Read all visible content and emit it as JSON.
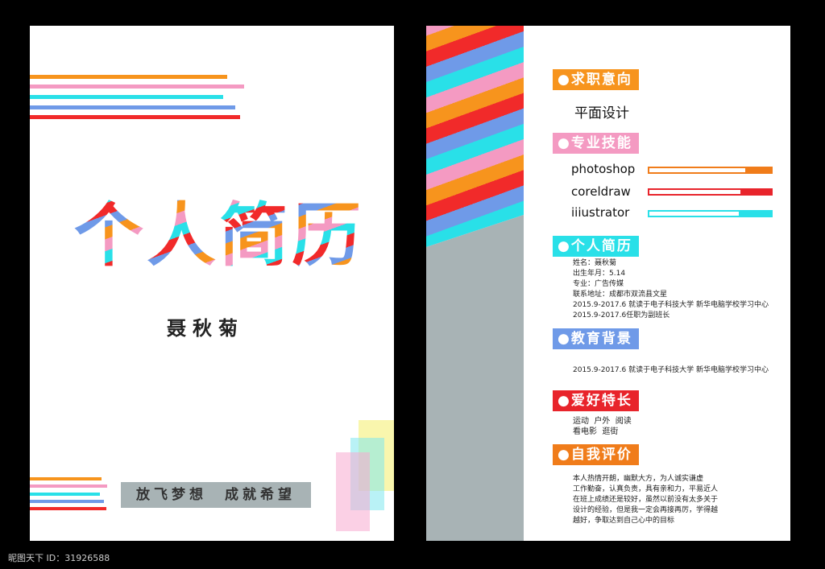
{
  "cover": {
    "title": "个人简历",
    "name": "聂秋菊",
    "slogan": "放飞梦想　成就希望"
  },
  "colors": {
    "orange": "#f7941d",
    "pink": "#f49ac2",
    "cyan": "#29e0e8",
    "blue": "#6f9ae8",
    "red": "#f12a2a",
    "gray": "#a8b3b5"
  },
  "resume": {
    "objective": {
      "heading": "●求职意向",
      "value": "平面设计"
    },
    "skills": {
      "heading": "●专业技能",
      "items": [
        {
          "name": "photoshop",
          "level": 0.8,
          "color": "#f07c1a"
        },
        {
          "name": "coreldraw",
          "level": 0.78,
          "color": "#e8242b"
        },
        {
          "name": "iiiustrator",
          "level": 0.74,
          "color": "#29e0e8"
        }
      ]
    },
    "profile": {
      "heading": "●个人简历",
      "lines": "姓名：聂秋菊\n出生年月：5.14\n专业：广告传媒\n联系地址：成都市双流县文星\n2015.9-2017.6 就读于电子科技大学 新华电脑学校学习中心\n2015.9-2017.6任职为副班长"
    },
    "education": {
      "heading": "●教育背景",
      "lines": "2015.9-2017.6 就读于电子科技大学 新华电脑学校学习中心"
    },
    "hobbies": {
      "heading": "●爱好特长",
      "lines": "运动  户外  阅读\n看电影  逛街"
    },
    "self_eval": {
      "heading": "●自我评价",
      "lines": "本人热情开朗，幽默大方，为人诚实谦虚\n工作勤奋，认真负责，具有亲和力，平易近人\n在班上成绩还是较好，虽然以前没有太多关于\n设计的经验，但是我一定会再接再厉，学得越\n越好，争取达到自己心中的目标"
    }
  },
  "watermark": "昵图天下 ID：31926588"
}
